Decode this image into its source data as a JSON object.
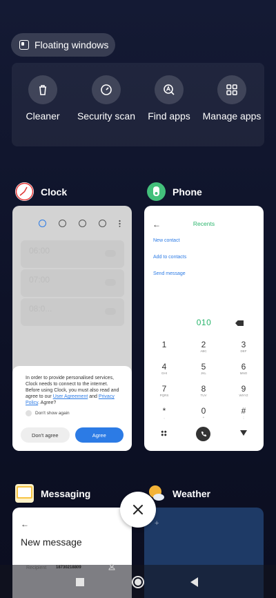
{
  "floating_windows": {
    "label": "Floating windows"
  },
  "tools": [
    {
      "label": "Cleaner",
      "icon": "trash-icon"
    },
    {
      "label": "Security scan",
      "icon": "security-gauge-icon"
    },
    {
      "label": "Find apps",
      "icon": "find-apps-icon"
    },
    {
      "label": "Manage apps",
      "icon": "grid-icon"
    }
  ],
  "clock": {
    "app_name": "Clock",
    "alarms": [
      "06:00",
      "07:00",
      "08:0..."
    ],
    "dialog": {
      "text_before": "In order to provide personalised services, Clock needs to connect to the internet. Before using Clock, you must also read and agree to our ",
      "user_agreement": "User Agreement",
      "and": " and ",
      "privacy_policy": "Privacy Policy",
      "text_after": ". Agree?",
      "dont_show": "Don't show again",
      "disagree": "Don't agree",
      "agree": "Agree"
    }
  },
  "phone": {
    "app_name": "Phone",
    "title": "Recents",
    "links": [
      "New contact",
      "Add to contacts",
      "Send message"
    ],
    "number": "010",
    "keys": [
      {
        "n": "1",
        "s": ""
      },
      {
        "n": "2",
        "s": "ABC"
      },
      {
        "n": "3",
        "s": "DEF"
      },
      {
        "n": "4",
        "s": "GHI"
      },
      {
        "n": "5",
        "s": "JKL"
      },
      {
        "n": "6",
        "s": "MNO"
      },
      {
        "n": "7",
        "s": "PQRS"
      },
      {
        "n": "8",
        "s": "TUV"
      },
      {
        "n": "9",
        "s": "WXYZ"
      },
      {
        "n": "*",
        "s": ","
      },
      {
        "n": "0",
        "s": "+"
      },
      {
        "n": "#",
        "s": ";"
      }
    ]
  },
  "messaging": {
    "app_name": "Messaging",
    "title": "New message",
    "recipient_label": "Recipient",
    "recipient_number": "18730218809"
  },
  "weather": {
    "app_name": "Weather"
  },
  "colors": {
    "accent_blue": "#2c7be5",
    "accent_green": "#2ab56c"
  }
}
